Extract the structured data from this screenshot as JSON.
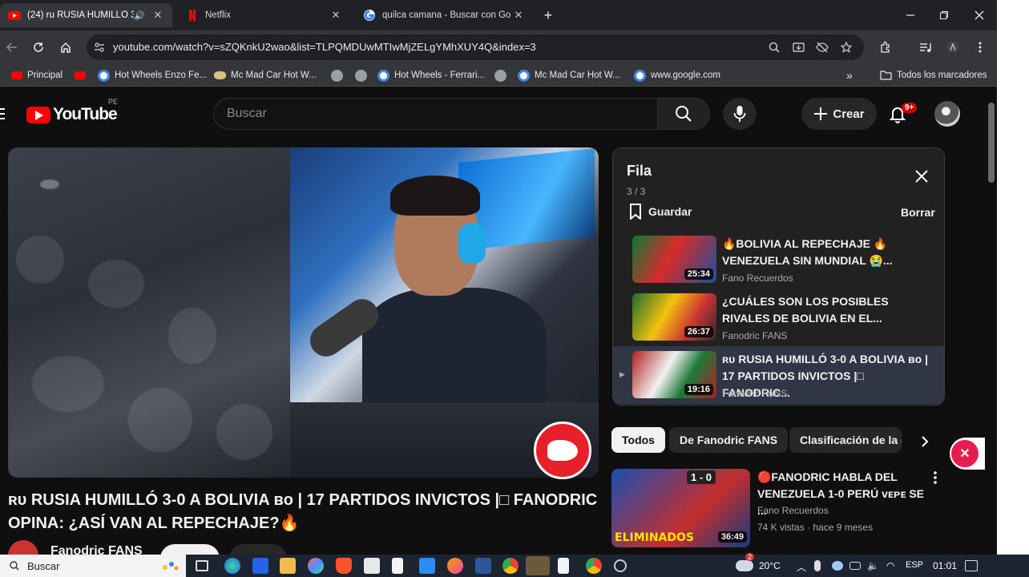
{
  "browser": {
    "tabs": [
      {
        "title": "(24) ru RUSIA HUMILLÓ 3-0",
        "active": true,
        "favicon": "youtube-icon"
      },
      {
        "title": "Netflix",
        "active": false,
        "favicon": "netflix-icon"
      },
      {
        "title": "quilca camana - Buscar con Go",
        "active": false,
        "favicon": "google-icon"
      }
    ],
    "url": "youtube.com/watch?v=sZQKnkU2wao&list=TLPQMDUwMTIwMjZELgYMhXUY4Q&index=3",
    "bookmarks": [
      {
        "label": "Principal",
        "icon": "youtube-icon"
      },
      {
        "label": "",
        "icon": "youtube-icon"
      },
      {
        "label": "Hot Wheels Enzo Fe...",
        "icon": "google-icon"
      },
      {
        "label": "Mc Mad Car Hot W...",
        "icon": "mcmad-icon"
      },
      {
        "label": "",
        "icon": "globe-icon"
      },
      {
        "label": "",
        "icon": "globe-icon"
      },
      {
        "label": "Hot Wheels - Ferrari...",
        "icon": "google-icon"
      },
      {
        "label": "",
        "icon": "globe-icon"
      },
      {
        "label": "Mc Mad Car Hot W...",
        "icon": "google-icon"
      },
      {
        "label": "www.google.com",
        "icon": "google-icon"
      }
    ],
    "all_bookmarks": "Todos los marcadores"
  },
  "youtube": {
    "logo_word": "YouTube",
    "country_code": "PE",
    "search_placeholder": "Buscar",
    "create_label": "Crear",
    "notif_count": "9+",
    "accent": "#ff0000"
  },
  "video": {
    "title": "ʀᴜ RUSIA HUMILLÓ 3-0 A BOLIVIA ʙᴏ | 17 PARTIDOS INVICTOS |□ FANODRIC OPINA: ¿ASÍ VAN AL REPECHAJE?🔥",
    "channel": "Fanodric FANS"
  },
  "queue": {
    "title": "Fila",
    "position": "3 / 3",
    "save_label": "Guardar",
    "clear_label": "Borrar",
    "items": [
      {
        "title": "🔥BOLIVIA AL REPECHAJE 🔥 VENEZUELA SIN MUNDIAL 😭...",
        "channel": "Fano Recuerdos",
        "duration": "25:34",
        "current": false
      },
      {
        "title": "¿CUÁLES SON LOS POSIBLES RIVALES DE BOLIVIA EN EL...",
        "channel": "Fanodric FANS",
        "duration": "26:37",
        "current": false
      },
      {
        "title": "ʀᴜ RUSIA HUMILLÓ 3-0 A BOLIVIA ʙᴏ | 17 PARTIDOS INVICTOS |□ FANODRIC...",
        "channel": "Fanodric FANS",
        "duration": "19:16",
        "current": true
      }
    ]
  },
  "chips": [
    {
      "label": "Todos",
      "active": true
    },
    {
      "label": "De Fanodric FANS",
      "active": false
    },
    {
      "label": "Clasificación de la (",
      "active": false
    }
  ],
  "recommendation": {
    "title": "🔴FANODRIC HABLA DEL VENEZUELA 1-0 PERÚ ᴠᴇᴘᴇ SE ...",
    "channel": "Fano Recuerdos",
    "meta": "74 K vistas · hace 9 meses",
    "duration": "36:49",
    "thumb_caption": "ELIMINADOS",
    "thumb_score": "1 - 0"
  },
  "taskbar": {
    "search_placeholder": "Buscar",
    "temperature": "20°C",
    "language": "ESP",
    "time": "01:01",
    "notif_badge": "2"
  }
}
